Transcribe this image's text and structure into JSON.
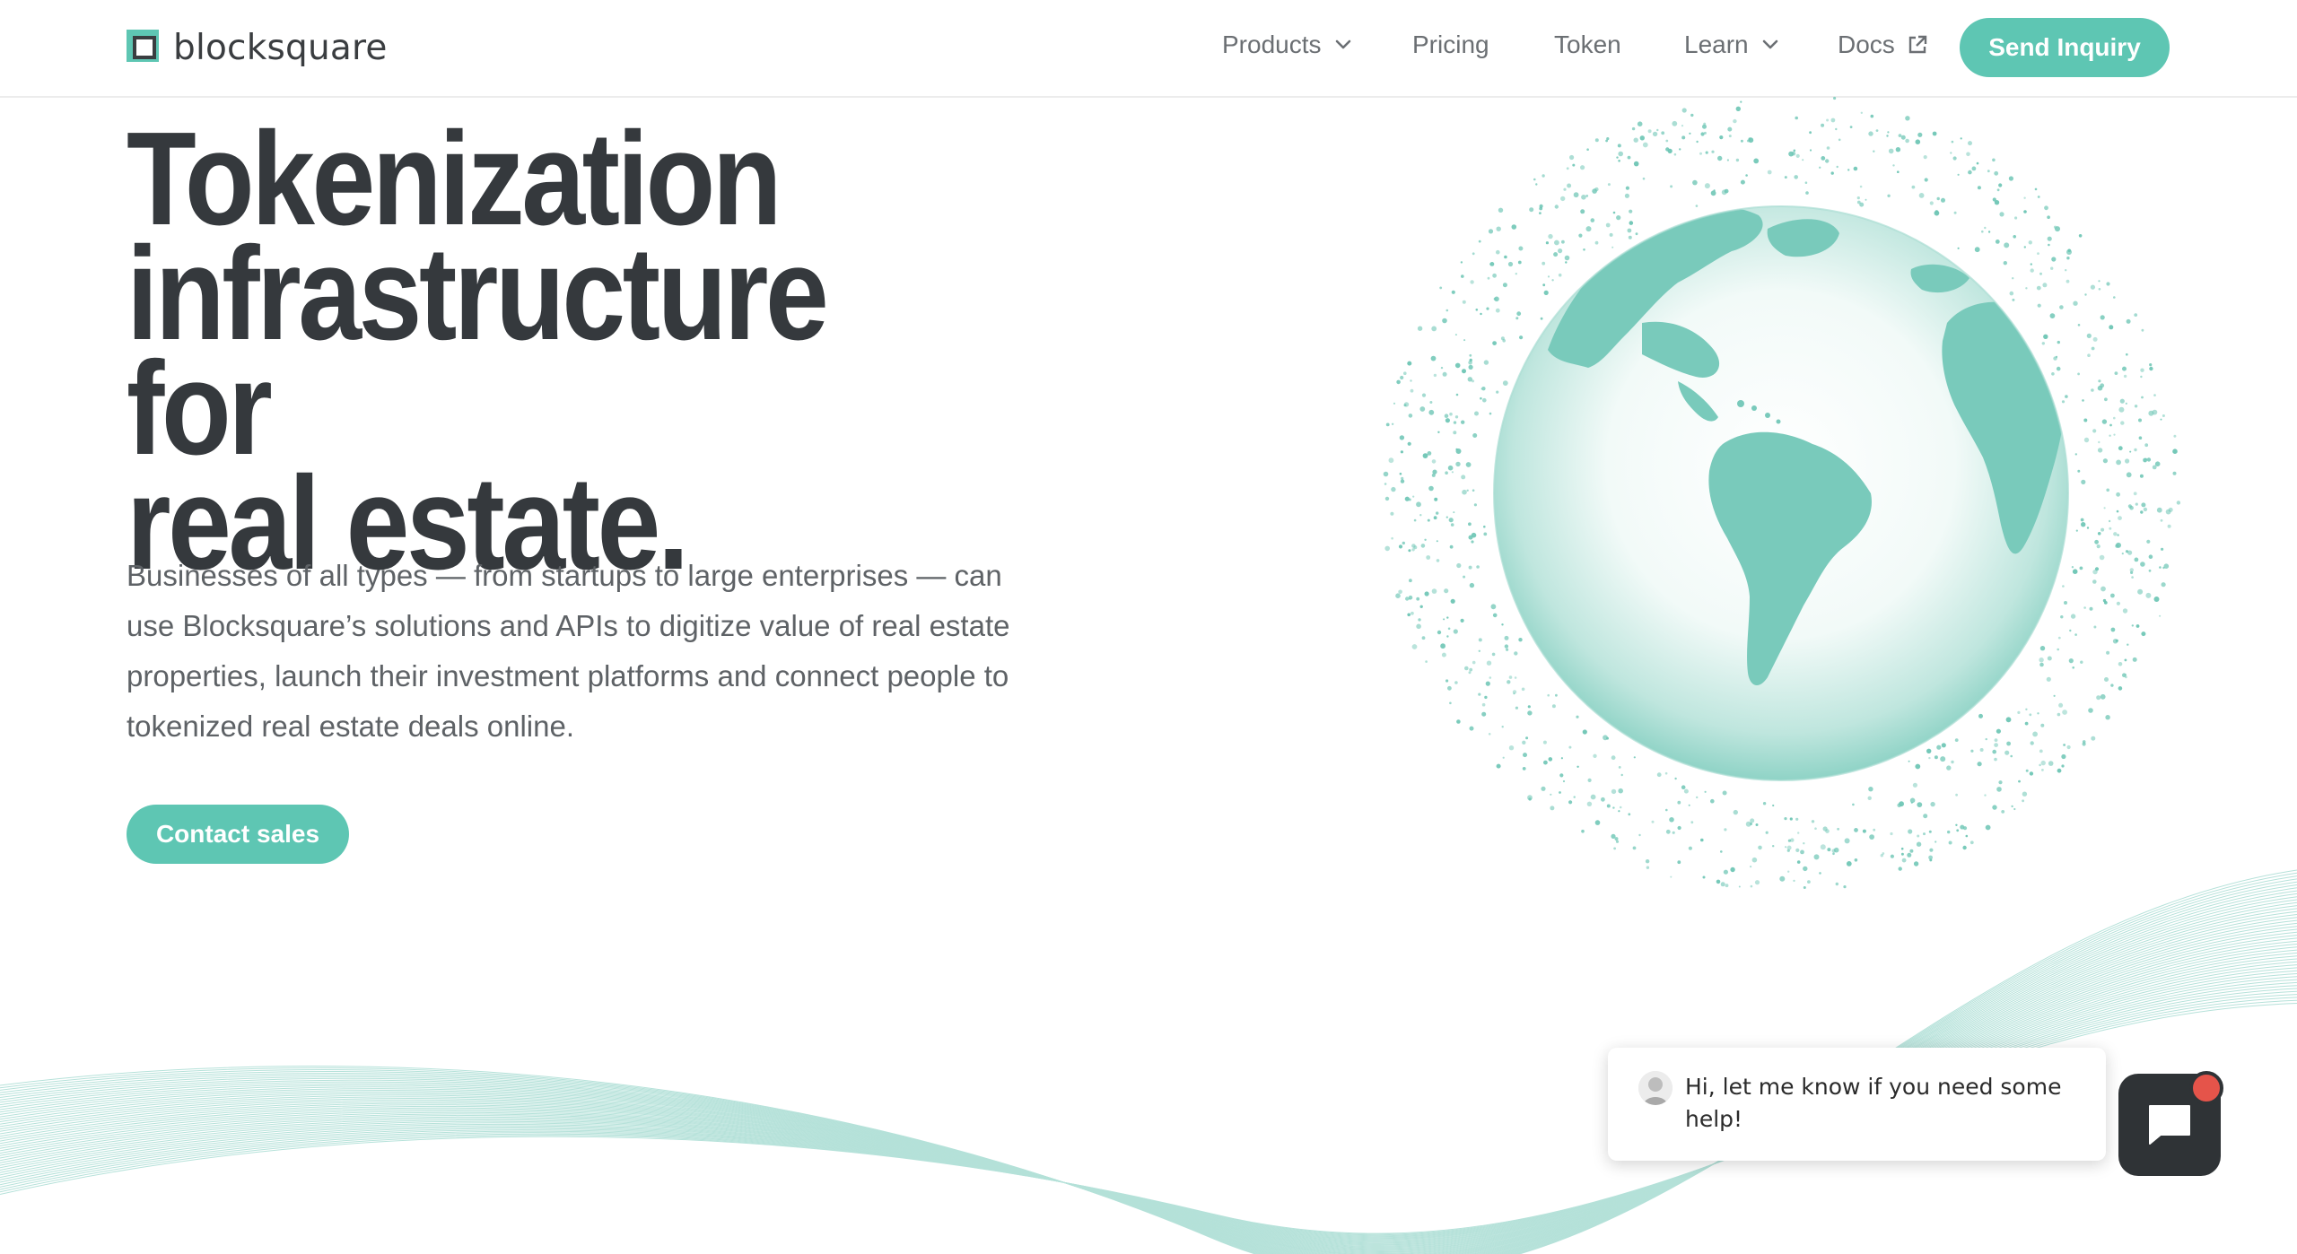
{
  "brand": {
    "name": "blocksquare",
    "accent_color": "#5ec6b3",
    "text_color": "#35393d"
  },
  "nav": {
    "items": [
      {
        "label": "Products",
        "icon": "chevron-down-icon"
      },
      {
        "label": "Pricing"
      },
      {
        "label": "Token"
      },
      {
        "label": "Learn",
        "icon": "chevron-down-icon"
      },
      {
        "label": "Docs",
        "icon": "external-link-icon"
      }
    ],
    "cta_label": "Send Inquiry"
  },
  "hero": {
    "title_lines": [
      "Tokenization",
      "infrastructure for",
      "real estate."
    ],
    "description": "Businesses of all types — from startups to large enterprises — can use Blocksquare’s solutions and APIs to digitize value of real estate properties, launch their investment platforms and connect people to tokenized real estate deals online.",
    "cta_label": "Contact sales",
    "illustration": "globe-with-particles"
  },
  "chat": {
    "message": "Hi, let me know if you need some help!",
    "avatar": "support-agent-avatar",
    "launcher_icon": "chat-icon",
    "notification_color": "#e5544a"
  }
}
